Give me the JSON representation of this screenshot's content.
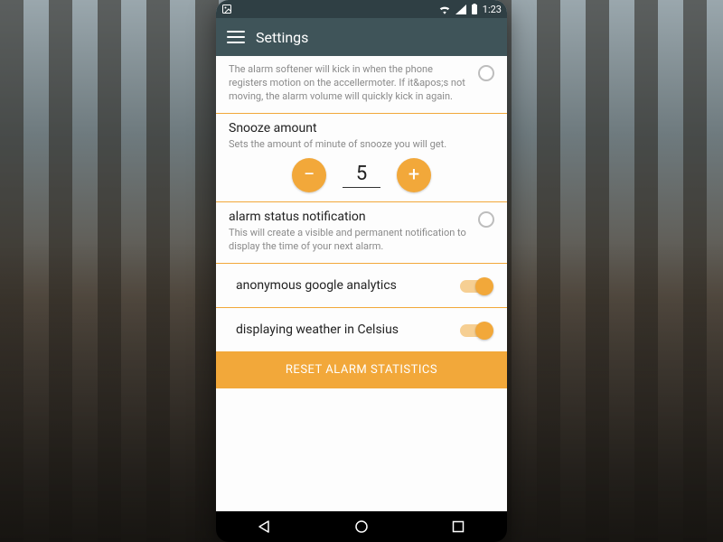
{
  "status": {
    "time": "1:23"
  },
  "appbar": {
    "title": "Settings"
  },
  "softener": {
    "desc": "The alarm softener will kick in when the phone registers motion on the accellermoter. If it&apos;s not moving, the alarm volume will quickly kick in again."
  },
  "snooze": {
    "title": "Snooze amount",
    "desc": "Sets the amount of minute of snooze you will get.",
    "value": "5",
    "minus": "−",
    "plus": "+"
  },
  "statusNotif": {
    "title": "alarm status notification",
    "desc": "This will create a visible and permanent notification to display the time of your next alarm."
  },
  "analytics": {
    "label": "anonymous google analytics"
  },
  "celsius": {
    "label": "displaying weather in Celsius"
  },
  "reset": {
    "label": "RESET ALARM STATISTICS"
  }
}
